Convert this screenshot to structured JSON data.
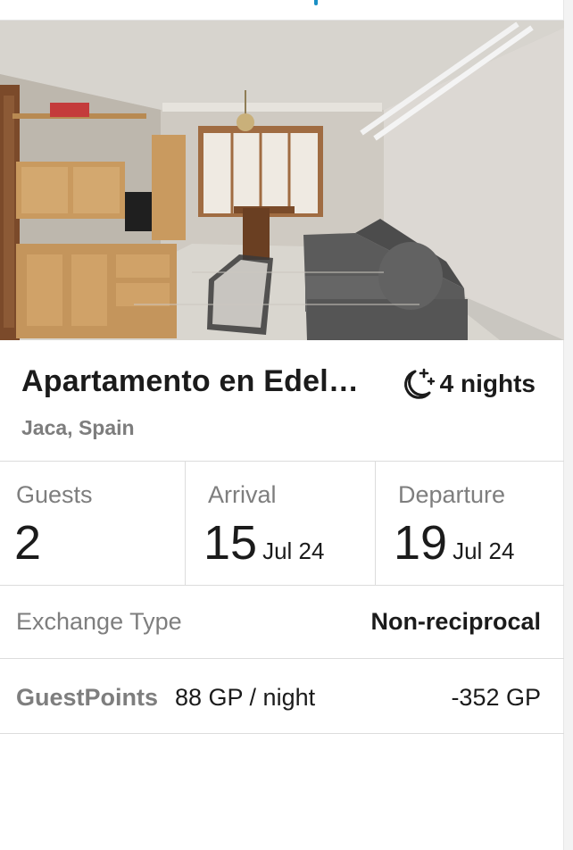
{
  "listing": {
    "photo_alt": "living room",
    "title": "Apartamento en Edel…",
    "nights": "4 nights",
    "nights_icon": "moon-stars-icon",
    "location": "Jaca, Spain"
  },
  "stay": {
    "guests_label": "Guests",
    "guests_value": "2",
    "arrival_label": "Arrival",
    "arrival_day": "15",
    "arrival_month": "Jul 24",
    "departure_label": "Departure",
    "departure_day": "19",
    "departure_month": "Jul 24"
  },
  "exchange": {
    "label": "Exchange Type",
    "value": "Non-reciprocal"
  },
  "points": {
    "label": "GuestPoints",
    "rate": "88 GP / night",
    "total": "-352 GP"
  },
  "colors": {
    "accent": "#1a8fc4",
    "muted_text": "#7e7e7e",
    "divider": "#dcdcdc"
  }
}
